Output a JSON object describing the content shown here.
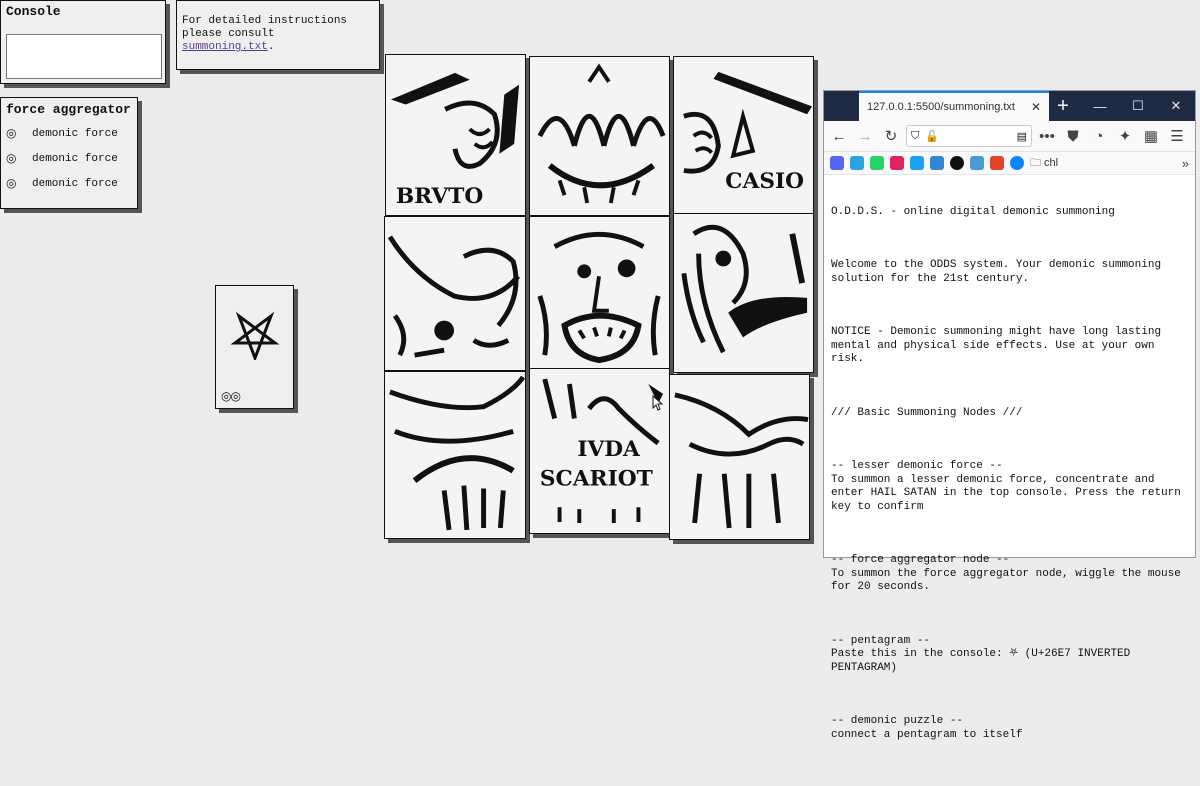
{
  "console": {
    "title": "Console",
    "input_value": ""
  },
  "aggregator": {
    "title": "force aggregator",
    "items": [
      {
        "icon": "◎",
        "label": "demonic force"
      },
      {
        "icon": "◎",
        "label": "demonic force"
      },
      {
        "icon": "◎",
        "label": "demonic force"
      }
    ]
  },
  "instructions": {
    "text": "For detailed instructions please consult",
    "link": "summoning.txt",
    "suffix": "."
  },
  "pentagram_card": {
    "rings": "◎◎"
  },
  "puzzle": {
    "tile_texts": {
      "brvto": "BRVTO",
      "casio": "CASIO",
      "ivda": "IVDA",
      "scariot": "SCARIOT"
    }
  },
  "browser": {
    "tab_title": "127.0.0.1:5500/summoning.txt",
    "tab_close": "✕",
    "new_tab": "+",
    "window_controls": [
      "—",
      "☐",
      "✕"
    ],
    "bookmark_folder": "chl",
    "document_lines": [
      "O.D.D.S. - online digital demonic summoning",
      "Welcome to the ODDS system. Your demonic summoning solution for the 21st century.",
      "NOTICE - Demonic summoning might have long lasting mental and physical side effects. Use at your own risk.",
      "/// Basic Summoning Nodes ///",
      "-- lesser demonic force --\nTo summon a lesser demonic force, concentrate and enter HAIL SATAN in the top console. Press the return key to confirm",
      "-- force aggregator node --\nTo summon the force aggregator node, wiggle the mouse for 20 seconds.",
      "-- pentagram --\nPaste this in the console: ⛧ (U+26E7 INVERTED PENTAGRAM)",
      "-- demonic puzzle --\nconnect a pentagram to itself"
    ]
  }
}
